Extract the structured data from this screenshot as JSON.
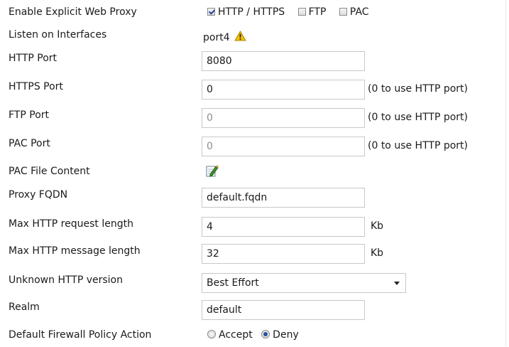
{
  "enable_proxy": {
    "label": "Enable Explicit Web Proxy",
    "options": [
      {
        "label": "HTTP / HTTPS",
        "checked": true
      },
      {
        "label": "FTP",
        "checked": false
      },
      {
        "label": "PAC",
        "checked": false
      }
    ]
  },
  "listen_interfaces": {
    "label": "Listen on Interfaces",
    "value": "port4",
    "icon": "warning-icon"
  },
  "http_port": {
    "label": "HTTP Port",
    "value": "8080"
  },
  "https_port": {
    "label": "HTTPS Port",
    "value": "0",
    "hint": "(0 to use HTTP port)"
  },
  "ftp_port": {
    "label": "FTP Port",
    "value": "0",
    "hint": "(0 to use HTTP port)"
  },
  "pac_port": {
    "label": "PAC Port",
    "value": "0",
    "hint": "(0 to use HTTP port)"
  },
  "pac_file_content": {
    "label": "PAC File Content",
    "icon": "edit-icon"
  },
  "proxy_fqdn": {
    "label": "Proxy FQDN",
    "value": "default.fqdn"
  },
  "max_request_length": {
    "label": "Max HTTP request length",
    "value": "4",
    "unit": "Kb"
  },
  "max_message_length": {
    "label": "Max HTTP message length",
    "value": "32",
    "unit": "Kb"
  },
  "unknown_http_version": {
    "label": "Unknown HTTP version",
    "value": "Best Effort"
  },
  "realm": {
    "label": "Realm",
    "value": "default"
  },
  "default_policy_action": {
    "label": "Default Firewall Policy Action",
    "options": [
      {
        "label": "Accept",
        "checked": false
      },
      {
        "label": "Deny",
        "checked": true
      }
    ]
  },
  "colors": {
    "warning": "#f2c200",
    "radio_selected": "#2b4f9e",
    "border": "#c8c8c8",
    "disabled_text": "#8c8c8c"
  }
}
